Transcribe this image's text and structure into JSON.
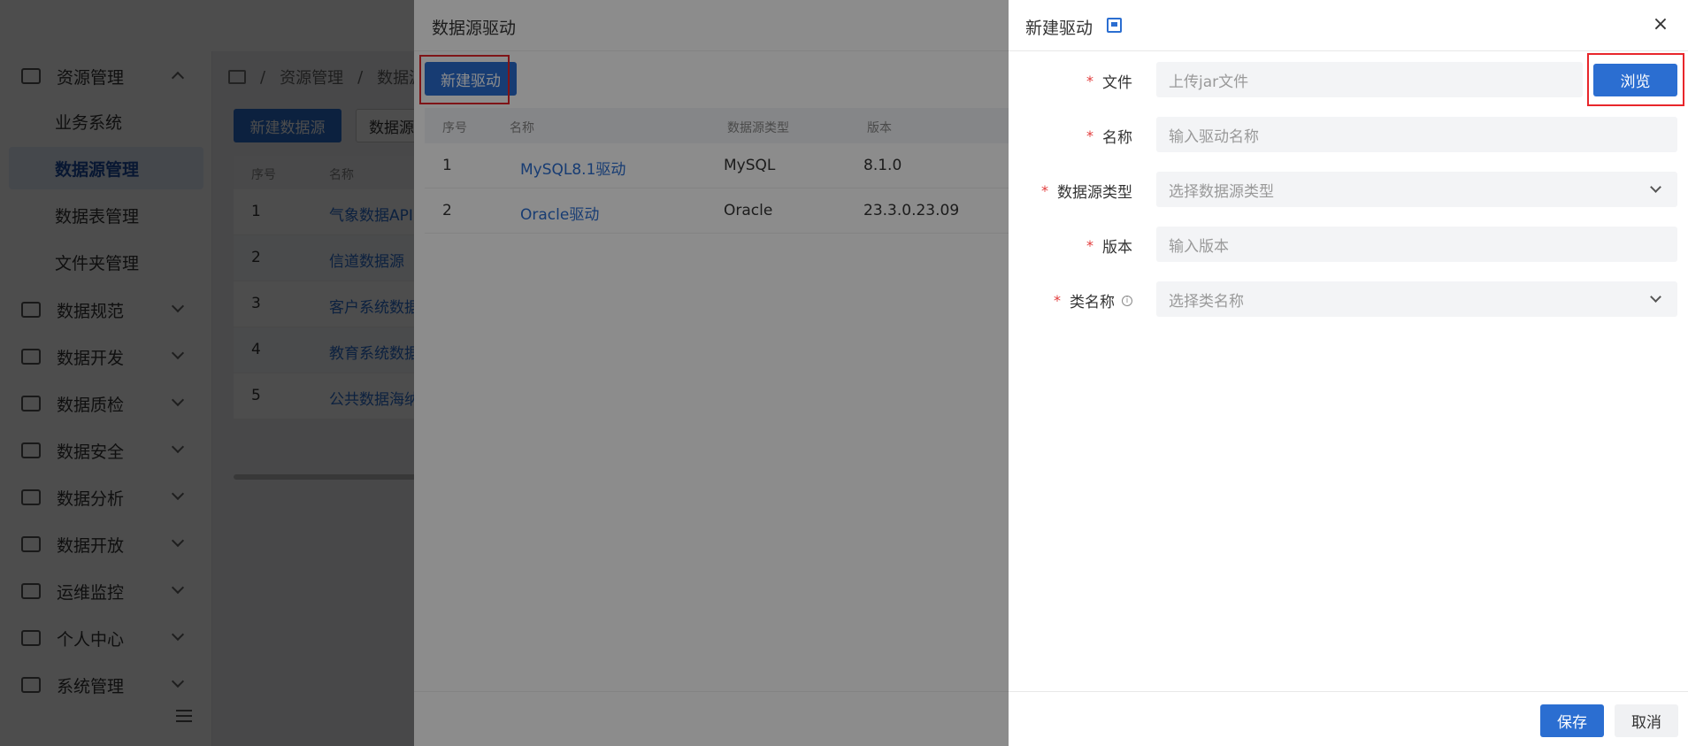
{
  "sidebar": {
    "menu": [
      {
        "label": "资源管理",
        "icon": "resource-icon",
        "expanded": true
      },
      {
        "label": "数据规范",
        "icon": "standard-icon"
      },
      {
        "label": "数据开发",
        "icon": "develop-icon"
      },
      {
        "label": "数据质检",
        "icon": "quality-icon"
      },
      {
        "label": "数据安全",
        "icon": "security-icon"
      },
      {
        "label": "数据分析",
        "icon": "analysis-icon"
      },
      {
        "label": "数据开放",
        "icon": "open-icon"
      },
      {
        "label": "运维监控",
        "icon": "monitor-icon"
      },
      {
        "label": "个人中心",
        "icon": "user-icon"
      },
      {
        "label": "系统管理",
        "icon": "system-icon"
      }
    ],
    "submenu": [
      "业务系统",
      "数据源管理",
      "数据表管理",
      "文件夹管理"
    ]
  },
  "breadcrumb": [
    "资源管理",
    "数据源"
  ],
  "background": {
    "new_datasource_btn": "新建数据源",
    "datasource_btn": "数据源",
    "table_headers": [
      "序号",
      "名称"
    ],
    "rows": [
      {
        "idx": "1",
        "name": "气象数据API"
      },
      {
        "idx": "2",
        "name": "信道数据源"
      },
      {
        "idx": "3",
        "name": "客户系统数据"
      },
      {
        "idx": "4",
        "name": "教育系统数据"
      },
      {
        "idx": "5",
        "name": "公共数据海纳"
      }
    ]
  },
  "drawer1": {
    "title": "数据源驱动",
    "new_button": "新建驱动",
    "headers": [
      "序号",
      "名称",
      "数据源类型",
      "版本"
    ],
    "rows": [
      {
        "idx": "1",
        "name": "MySQL8.1驱动",
        "type": "MySQL",
        "version": "8.1.0"
      },
      {
        "idx": "2",
        "name": "Oracle驱动",
        "type": "Oracle",
        "version": "23.3.0.23.09"
      }
    ]
  },
  "drawer2": {
    "title": "新建驱动",
    "close": "×",
    "fields": {
      "file": {
        "label": "文件",
        "placeholder": "上传jar文件",
        "button": "浏览"
      },
      "name": {
        "label": "名称",
        "placeholder": "输入驱动名称"
      },
      "type": {
        "label": "数据源类型",
        "placeholder": "选择数据源类型"
      },
      "version": {
        "label": "版本",
        "placeholder": "输入版本"
      },
      "class_name": {
        "label": "类名称",
        "placeholder": "选择类名称",
        "info": "i"
      }
    },
    "required_mark": "*",
    "save": "保存",
    "cancel": "取消"
  },
  "colors": {
    "primary": "#2b6ed1",
    "annotation": "#e8262b",
    "required": "#e23b3b"
  }
}
